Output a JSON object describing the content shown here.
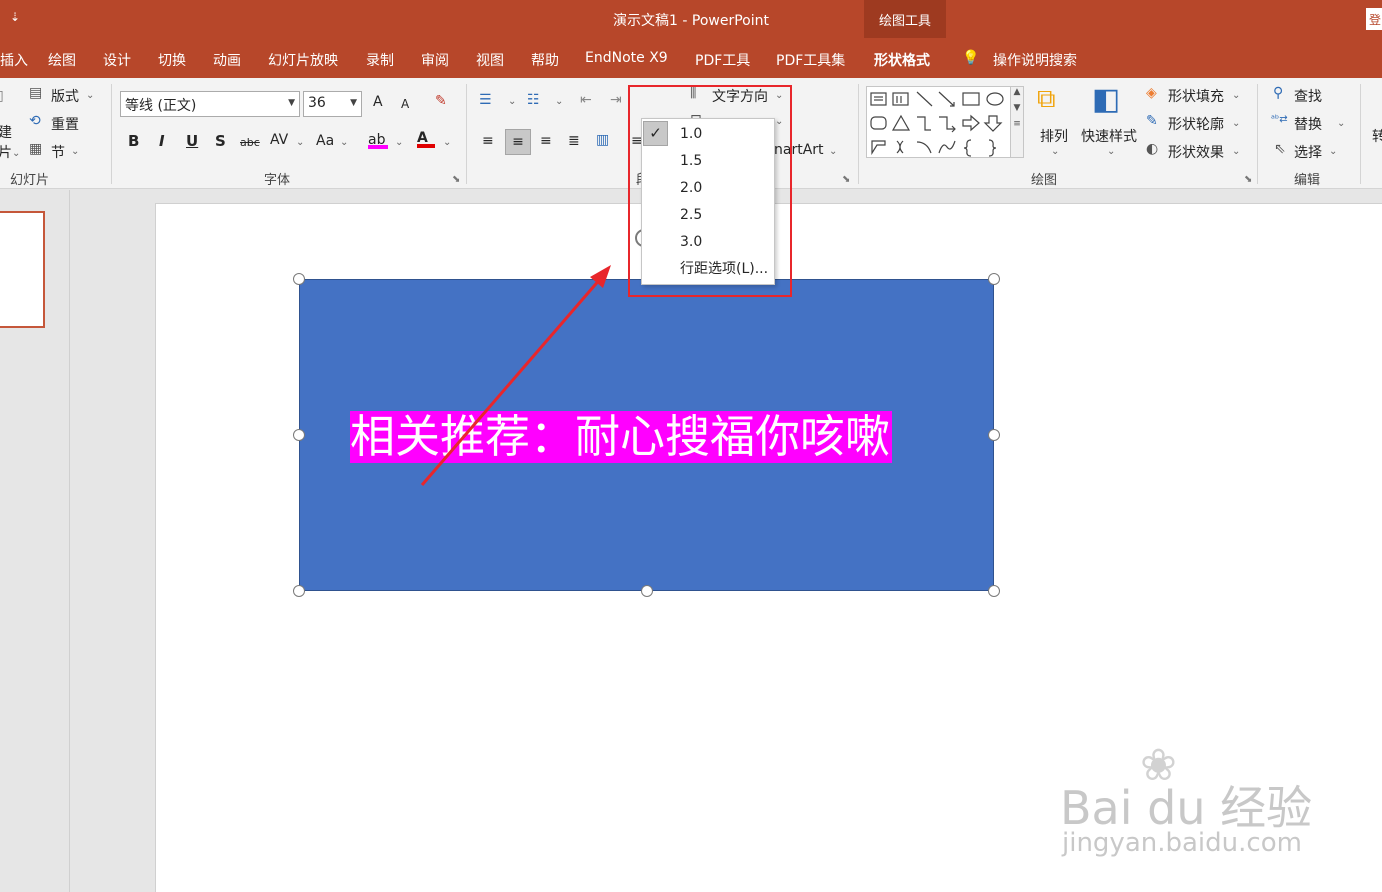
{
  "titlebar": {
    "quick_access": "⇣",
    "title": "演示文稿1  -  PowerPoint",
    "context_label": "绘图工具",
    "account_char": "登"
  },
  "tabs": {
    "insert": "插入",
    "draw": "绘图",
    "design": "设计",
    "transitions": "切换",
    "animations": "动画",
    "slideshow": "幻灯片放映",
    "record": "录制",
    "review": "审阅",
    "view": "视图",
    "help": "帮助",
    "endnote": "EndNote X9",
    "pdf": "PDF工具",
    "pdfset": "PDF工具集",
    "shapeformat": "形状格式",
    "tellme": "操作说明搜索"
  },
  "ribbon": {
    "slides": {
      "layout": "版式",
      "reset": "重置",
      "section": "节",
      "new1": "建",
      "new2": "片",
      "label": "幻灯片"
    },
    "font": {
      "name": "等线 (正文)",
      "size": "36",
      "bold": "B",
      "italic": "I",
      "underline": "U",
      "shadow": "S",
      "strike": "abc",
      "spacing": "AV",
      "case": "Aa",
      "grow": "A",
      "shrink": "A",
      "label": "字体"
    },
    "paragraph": {
      "text_direction": "文字方向",
      "smartart": "nartArt",
      "label_partial": "段"
    },
    "drawing": {
      "arrange": "排列",
      "quick_styles": "快速样式",
      "fill": "形状填充",
      "outline": "形状轮廓",
      "effects": "形状效果",
      "label": "绘图"
    },
    "editing": {
      "find": "查找",
      "replace": "替换",
      "select": "选择",
      "label": "编辑",
      "cut_char": "转"
    }
  },
  "line_spacing_menu": {
    "options": [
      "1.0",
      "1.5",
      "2.0",
      "2.5",
      "3.0"
    ],
    "selected": "1.0",
    "more": "行距选项(L)..."
  },
  "slide": {
    "text": "相关推荐：耐心搜福你咳嗽"
  },
  "watermark": {
    "logo": "Bai du 经验",
    "url": "jingyan.baidu.com"
  },
  "colors": {
    "accent": "#b7472a",
    "shape_fill": "#4472c4",
    "highlight": "#ff00ff",
    "annotation": "#e8262b"
  }
}
